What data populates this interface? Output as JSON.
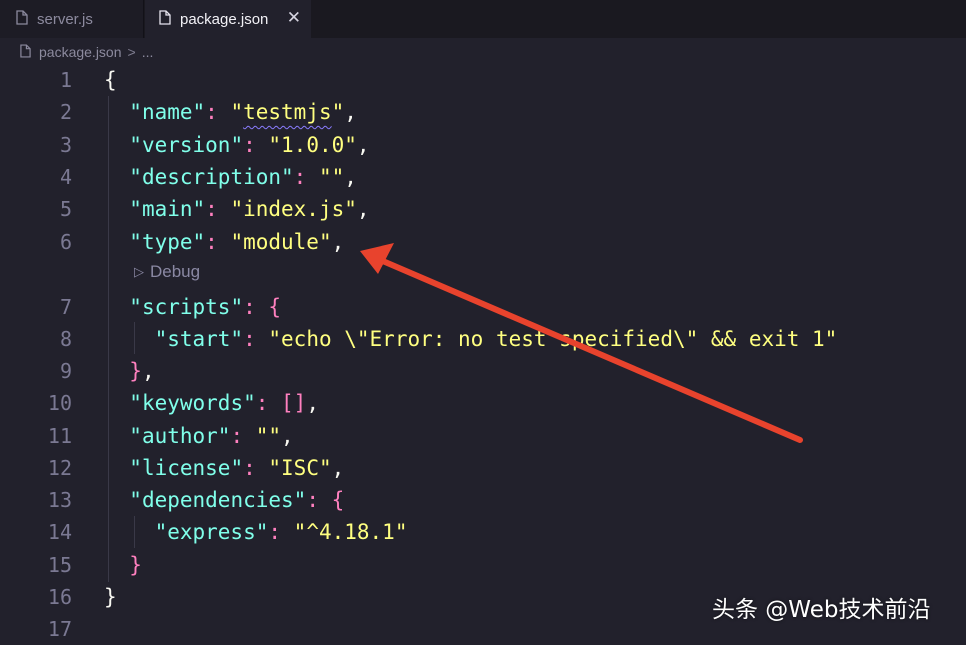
{
  "tabs": [
    {
      "label": "server.js",
      "active": false
    },
    {
      "label": "package.json",
      "active": true,
      "close_glyph": "✕"
    }
  ],
  "breadcrumb": {
    "file": "package.json",
    "separator": ">",
    "rest": "..."
  },
  "codelens": {
    "label": "Debug"
  },
  "lines": [
    {
      "n": "1",
      "tokens": [
        {
          "t": "{",
          "c": "w"
        }
      ]
    },
    {
      "n": "2",
      "tokens": [
        {
          "t": "  ",
          "c": "w"
        },
        {
          "t": "\"name\"",
          "c": "k"
        },
        {
          "t": ": ",
          "c": "p"
        },
        {
          "t": "\"",
          "c": "s"
        },
        {
          "t": "testmjs",
          "c": "s squig"
        },
        {
          "t": "\"",
          "c": "s"
        },
        {
          "t": ",",
          "c": "w"
        }
      ]
    },
    {
      "n": "3",
      "tokens": [
        {
          "t": "  ",
          "c": "w"
        },
        {
          "t": "\"version\"",
          "c": "k"
        },
        {
          "t": ": ",
          "c": "p"
        },
        {
          "t": "\"1.0.0\"",
          "c": "s"
        },
        {
          "t": ",",
          "c": "w"
        }
      ]
    },
    {
      "n": "4",
      "tokens": [
        {
          "t": "  ",
          "c": "w"
        },
        {
          "t": "\"description\"",
          "c": "k"
        },
        {
          "t": ": ",
          "c": "p"
        },
        {
          "t": "\"\"",
          "c": "s"
        },
        {
          "t": ",",
          "c": "w"
        }
      ]
    },
    {
      "n": "5",
      "tokens": [
        {
          "t": "  ",
          "c": "w"
        },
        {
          "t": "\"main\"",
          "c": "k"
        },
        {
          "t": ": ",
          "c": "p"
        },
        {
          "t": "\"index.js\"",
          "c": "s"
        },
        {
          "t": ",",
          "c": "w"
        }
      ]
    },
    {
      "n": "6",
      "tokens": [
        {
          "t": "  ",
          "c": "w"
        },
        {
          "t": "\"type\"",
          "c": "k"
        },
        {
          "t": ": ",
          "c": "p"
        },
        {
          "t": "\"module\"",
          "c": "s"
        },
        {
          "t": ",",
          "c": "w"
        }
      ]
    },
    {
      "n": "7",
      "tokens": [
        {
          "t": "  ",
          "c": "w"
        },
        {
          "t": "\"scripts\"",
          "c": "k"
        },
        {
          "t": ": ",
          "c": "p"
        },
        {
          "t": "{",
          "c": "p"
        }
      ]
    },
    {
      "n": "8",
      "tokens": [
        {
          "t": "    ",
          "c": "w"
        },
        {
          "t": "\"start\"",
          "c": "k"
        },
        {
          "t": ": ",
          "c": "p"
        },
        {
          "t": "\"echo \\\"Error: no test specified\\\" && exit 1\"",
          "c": "s"
        }
      ]
    },
    {
      "n": "9",
      "tokens": [
        {
          "t": "  ",
          "c": "w"
        },
        {
          "t": "}",
          "c": "p"
        },
        {
          "t": ",",
          "c": "w"
        }
      ]
    },
    {
      "n": "10",
      "tokens": [
        {
          "t": "  ",
          "c": "w"
        },
        {
          "t": "\"keywords\"",
          "c": "k"
        },
        {
          "t": ": ",
          "c": "p"
        },
        {
          "t": "[]",
          "c": "p"
        },
        {
          "t": ",",
          "c": "w"
        }
      ]
    },
    {
      "n": "11",
      "tokens": [
        {
          "t": "  ",
          "c": "w"
        },
        {
          "t": "\"author\"",
          "c": "k"
        },
        {
          "t": ": ",
          "c": "p"
        },
        {
          "t": "\"\"",
          "c": "s"
        },
        {
          "t": ",",
          "c": "w"
        }
      ]
    },
    {
      "n": "12",
      "tokens": [
        {
          "t": "  ",
          "c": "w"
        },
        {
          "t": "\"license\"",
          "c": "k"
        },
        {
          "t": ": ",
          "c": "p"
        },
        {
          "t": "\"ISC\"",
          "c": "s"
        },
        {
          "t": ",",
          "c": "w"
        }
      ]
    },
    {
      "n": "13",
      "tokens": [
        {
          "t": "  ",
          "c": "w"
        },
        {
          "t": "\"dependencies\"",
          "c": "k"
        },
        {
          "t": ": ",
          "c": "p"
        },
        {
          "t": "{",
          "c": "p"
        }
      ]
    },
    {
      "n": "14",
      "tokens": [
        {
          "t": "    ",
          "c": "w"
        },
        {
          "t": "\"express\"",
          "c": "k"
        },
        {
          "t": ": ",
          "c": "p"
        },
        {
          "t": "\"^4.18.1\"",
          "c": "s"
        }
      ]
    },
    {
      "n": "15",
      "tokens": [
        {
          "t": "  ",
          "c": "w"
        },
        {
          "t": "}",
          "c": "p"
        }
      ]
    },
    {
      "n": "16",
      "tokens": [
        {
          "t": "}",
          "c": "w"
        }
      ]
    },
    {
      "n": "17",
      "tokens": []
    }
  ],
  "watermark": "头条 @Web技术前沿",
  "colors": {
    "background": "#22212c",
    "key": "#80ffea",
    "string": "#ffff80",
    "punctuation": "#ff80bf",
    "arrow": "#e8432d"
  }
}
